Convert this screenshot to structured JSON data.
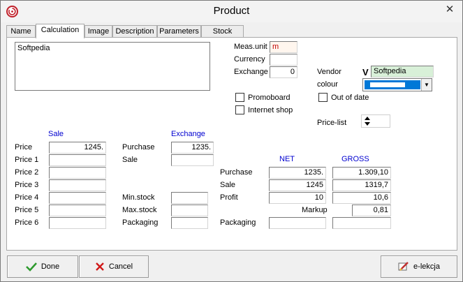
{
  "window": {
    "title": "Product"
  },
  "tabs": [
    {
      "label": "Name"
    },
    {
      "label": "Calculation"
    },
    {
      "label": "Image"
    },
    {
      "label": "Description"
    },
    {
      "label": "Parameters"
    },
    {
      "label": "Stock"
    }
  ],
  "memo": {
    "text": "Softpedia"
  },
  "top": {
    "meas_unit_label": "Meas.unit",
    "meas_unit_value": "m",
    "currency_label": "Currency",
    "currency_value": "",
    "exchange_label": "Exchange",
    "exchange_value": "0",
    "vendor_label": "Vendor",
    "vendor_mark": "V",
    "vendor_value": "Softpedia",
    "colour_label": "colour"
  },
  "checks": {
    "promoboard": "Promoboard",
    "internet_shop": "Internet shop",
    "out_of_date": "Out of date"
  },
  "price_list_label": "Price-list",
  "sale_header": "Sale",
  "exchange_header": "Exchange",
  "prices": [
    {
      "label": "Price",
      "value": "1245."
    },
    {
      "label": "Price 1",
      "value": ""
    },
    {
      "label": "Price 2",
      "value": ""
    },
    {
      "label": "Price 3",
      "value": ""
    },
    {
      "label": "Price 4",
      "value": ""
    },
    {
      "label": "Price 5",
      "value": ""
    },
    {
      "label": "Price 6",
      "value": ""
    }
  ],
  "mid": {
    "purchase_label": "Purchase",
    "purchase_value": "1235.",
    "sale_label": "Sale",
    "sale_value": "",
    "min_stock_label": "Min.stock",
    "min_stock_value": "",
    "max_stock_label": "Max.stock",
    "max_stock_value": "",
    "packaging_label": "Packaging",
    "packaging_value": ""
  },
  "calc": {
    "net_header": "NET",
    "gross_header": "GROSS",
    "purchase_label": "Purchase",
    "purchase_net": "1235.",
    "purchase_gross": "1.309,10",
    "sale_label": "Sale",
    "sale_net": "1245",
    "sale_gross": "1319,7",
    "profit_label": "Profit",
    "profit_net": "10",
    "profit_gross": "10,6",
    "markup_label": "Markup",
    "markup_value": "0,81",
    "packaging_label": "Packaging",
    "packaging_net": "",
    "packaging_gross": ""
  },
  "buttons": {
    "done": "Done",
    "cancel": "Cancel",
    "elekcja": "e-lekcja"
  },
  "colors": {
    "header_blue": "#0000d0",
    "colour_swatch": "#0078d7",
    "vendor_bg": "#d8f0d8"
  }
}
